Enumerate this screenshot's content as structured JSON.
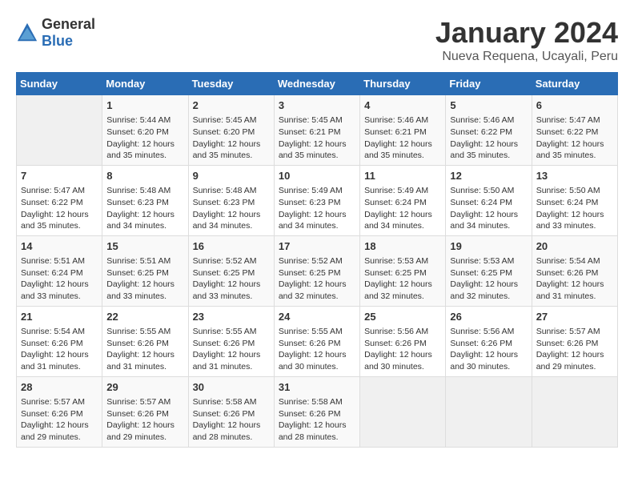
{
  "header": {
    "logo_general": "General",
    "logo_blue": "Blue",
    "month": "January 2024",
    "location": "Nueva Requena, Ucayali, Peru"
  },
  "weekdays": [
    "Sunday",
    "Monday",
    "Tuesday",
    "Wednesday",
    "Thursday",
    "Friday",
    "Saturday"
  ],
  "weeks": [
    [
      {
        "day": "",
        "sunrise": "",
        "sunset": "",
        "daylight": ""
      },
      {
        "day": "1",
        "sunrise": "Sunrise: 5:44 AM",
        "sunset": "Sunset: 6:20 PM",
        "daylight": "Daylight: 12 hours and 35 minutes."
      },
      {
        "day": "2",
        "sunrise": "Sunrise: 5:45 AM",
        "sunset": "Sunset: 6:20 PM",
        "daylight": "Daylight: 12 hours and 35 minutes."
      },
      {
        "day": "3",
        "sunrise": "Sunrise: 5:45 AM",
        "sunset": "Sunset: 6:21 PM",
        "daylight": "Daylight: 12 hours and 35 minutes."
      },
      {
        "day": "4",
        "sunrise": "Sunrise: 5:46 AM",
        "sunset": "Sunset: 6:21 PM",
        "daylight": "Daylight: 12 hours and 35 minutes."
      },
      {
        "day": "5",
        "sunrise": "Sunrise: 5:46 AM",
        "sunset": "Sunset: 6:22 PM",
        "daylight": "Daylight: 12 hours and 35 minutes."
      },
      {
        "day": "6",
        "sunrise": "Sunrise: 5:47 AM",
        "sunset": "Sunset: 6:22 PM",
        "daylight": "Daylight: 12 hours and 35 minutes."
      }
    ],
    [
      {
        "day": "7",
        "sunrise": "Sunrise: 5:47 AM",
        "sunset": "Sunset: 6:22 PM",
        "daylight": "Daylight: 12 hours and 35 minutes."
      },
      {
        "day": "8",
        "sunrise": "Sunrise: 5:48 AM",
        "sunset": "Sunset: 6:23 PM",
        "daylight": "Daylight: 12 hours and 34 minutes."
      },
      {
        "day": "9",
        "sunrise": "Sunrise: 5:48 AM",
        "sunset": "Sunset: 6:23 PM",
        "daylight": "Daylight: 12 hours and 34 minutes."
      },
      {
        "day": "10",
        "sunrise": "Sunrise: 5:49 AM",
        "sunset": "Sunset: 6:23 PM",
        "daylight": "Daylight: 12 hours and 34 minutes."
      },
      {
        "day": "11",
        "sunrise": "Sunrise: 5:49 AM",
        "sunset": "Sunset: 6:24 PM",
        "daylight": "Daylight: 12 hours and 34 minutes."
      },
      {
        "day": "12",
        "sunrise": "Sunrise: 5:50 AM",
        "sunset": "Sunset: 6:24 PM",
        "daylight": "Daylight: 12 hours and 34 minutes."
      },
      {
        "day": "13",
        "sunrise": "Sunrise: 5:50 AM",
        "sunset": "Sunset: 6:24 PM",
        "daylight": "Daylight: 12 hours and 33 minutes."
      }
    ],
    [
      {
        "day": "14",
        "sunrise": "Sunrise: 5:51 AM",
        "sunset": "Sunset: 6:24 PM",
        "daylight": "Daylight: 12 hours and 33 minutes."
      },
      {
        "day": "15",
        "sunrise": "Sunrise: 5:51 AM",
        "sunset": "Sunset: 6:25 PM",
        "daylight": "Daylight: 12 hours and 33 minutes."
      },
      {
        "day": "16",
        "sunrise": "Sunrise: 5:52 AM",
        "sunset": "Sunset: 6:25 PM",
        "daylight": "Daylight: 12 hours and 33 minutes."
      },
      {
        "day": "17",
        "sunrise": "Sunrise: 5:52 AM",
        "sunset": "Sunset: 6:25 PM",
        "daylight": "Daylight: 12 hours and 32 minutes."
      },
      {
        "day": "18",
        "sunrise": "Sunrise: 5:53 AM",
        "sunset": "Sunset: 6:25 PM",
        "daylight": "Daylight: 12 hours and 32 minutes."
      },
      {
        "day": "19",
        "sunrise": "Sunrise: 5:53 AM",
        "sunset": "Sunset: 6:25 PM",
        "daylight": "Daylight: 12 hours and 32 minutes."
      },
      {
        "day": "20",
        "sunrise": "Sunrise: 5:54 AM",
        "sunset": "Sunset: 6:26 PM",
        "daylight": "Daylight: 12 hours and 31 minutes."
      }
    ],
    [
      {
        "day": "21",
        "sunrise": "Sunrise: 5:54 AM",
        "sunset": "Sunset: 6:26 PM",
        "daylight": "Daylight: 12 hours and 31 minutes."
      },
      {
        "day": "22",
        "sunrise": "Sunrise: 5:55 AM",
        "sunset": "Sunset: 6:26 PM",
        "daylight": "Daylight: 12 hours and 31 minutes."
      },
      {
        "day": "23",
        "sunrise": "Sunrise: 5:55 AM",
        "sunset": "Sunset: 6:26 PM",
        "daylight": "Daylight: 12 hours and 31 minutes."
      },
      {
        "day": "24",
        "sunrise": "Sunrise: 5:55 AM",
        "sunset": "Sunset: 6:26 PM",
        "daylight": "Daylight: 12 hours and 30 minutes."
      },
      {
        "day": "25",
        "sunrise": "Sunrise: 5:56 AM",
        "sunset": "Sunset: 6:26 PM",
        "daylight": "Daylight: 12 hours and 30 minutes."
      },
      {
        "day": "26",
        "sunrise": "Sunrise: 5:56 AM",
        "sunset": "Sunset: 6:26 PM",
        "daylight": "Daylight: 12 hours and 30 minutes."
      },
      {
        "day": "27",
        "sunrise": "Sunrise: 5:57 AM",
        "sunset": "Sunset: 6:26 PM",
        "daylight": "Daylight: 12 hours and 29 minutes."
      }
    ],
    [
      {
        "day": "28",
        "sunrise": "Sunrise: 5:57 AM",
        "sunset": "Sunset: 6:26 PM",
        "daylight": "Daylight: 12 hours and 29 minutes."
      },
      {
        "day": "29",
        "sunrise": "Sunrise: 5:57 AM",
        "sunset": "Sunset: 6:26 PM",
        "daylight": "Daylight: 12 hours and 29 minutes."
      },
      {
        "day": "30",
        "sunrise": "Sunrise: 5:58 AM",
        "sunset": "Sunset: 6:26 PM",
        "daylight": "Daylight: 12 hours and 28 minutes."
      },
      {
        "day": "31",
        "sunrise": "Sunrise: 5:58 AM",
        "sunset": "Sunset: 6:26 PM",
        "daylight": "Daylight: 12 hours and 28 minutes."
      },
      {
        "day": "",
        "sunrise": "",
        "sunset": "",
        "daylight": ""
      },
      {
        "day": "",
        "sunrise": "",
        "sunset": "",
        "daylight": ""
      },
      {
        "day": "",
        "sunrise": "",
        "sunset": "",
        "daylight": ""
      }
    ]
  ]
}
